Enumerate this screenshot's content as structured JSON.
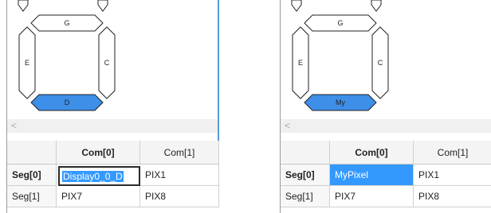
{
  "colors": {
    "segment_fill": "#ffffff",
    "segment_active_fill": "#3d8fe8",
    "segment_stroke": "#222222",
    "accent_border": "#5b9bd5",
    "selection": "#3399ff"
  },
  "panels": [
    {
      "segments": {
        "top": "G",
        "left": "E",
        "right": "C",
        "bottom": "D"
      },
      "scroll_arrow": "<",
      "grid": {
        "col_headers": [
          "Com[0]",
          "Com[1]"
        ],
        "rows": [
          {
            "label": "Seg[0]",
            "cells": [
              "Display0_0_D",
              "PIX1"
            ]
          },
          {
            "label": "Seg[1]",
            "cells": [
              "PIX7",
              "PIX8"
            ]
          }
        ]
      }
    },
    {
      "segments": {
        "top": "G",
        "left": "E",
        "right": "C",
        "bottom": "My"
      },
      "scroll_arrow": "<",
      "grid": {
        "col_headers": [
          "Com[0]",
          "Com[1]"
        ],
        "rows": [
          {
            "label": "Seg[0]",
            "cells": [
              "MyPixel",
              "PIX1"
            ]
          },
          {
            "label": "Seg[1]",
            "cells": [
              "PIX7",
              "PIX8"
            ]
          }
        ]
      }
    }
  ]
}
